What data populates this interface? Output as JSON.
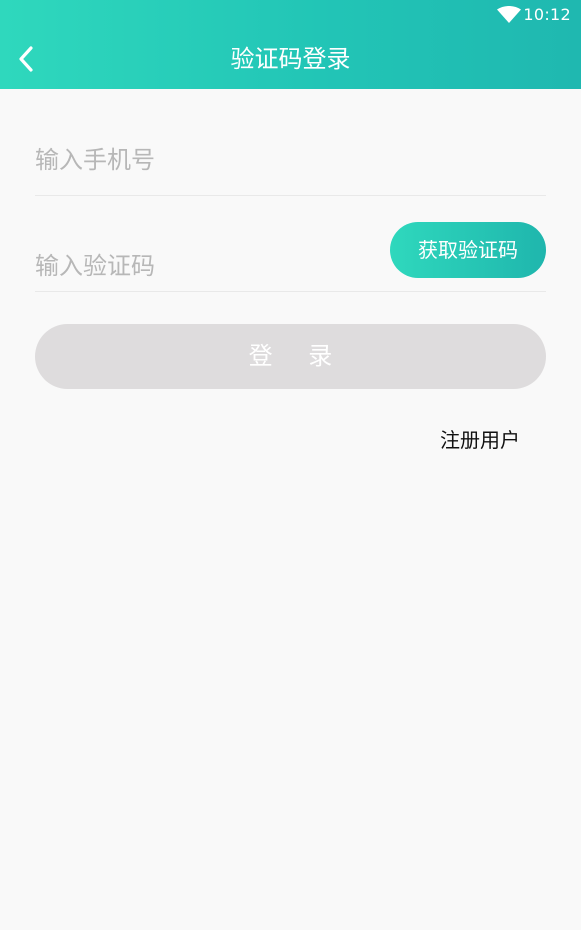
{
  "status_bar": {
    "time": "10:12",
    "wifi_icon": "wifi-icon"
  },
  "header": {
    "title": "验证码登录",
    "back_icon": "back-chevron-icon",
    "gradient_start": "#2fd8bd",
    "gradient_end": "#1fb8b0"
  },
  "form": {
    "phone_placeholder": "输入手机号",
    "code_placeholder": "输入验证码",
    "get_code_label": "获取验证码",
    "login_label": "登 录",
    "register_label": "注册用户"
  },
  "colors": {
    "page_background": "#f9f9f9",
    "login_button_disabled": "#dedcdd",
    "placeholder_text": "#b7b7b7"
  }
}
